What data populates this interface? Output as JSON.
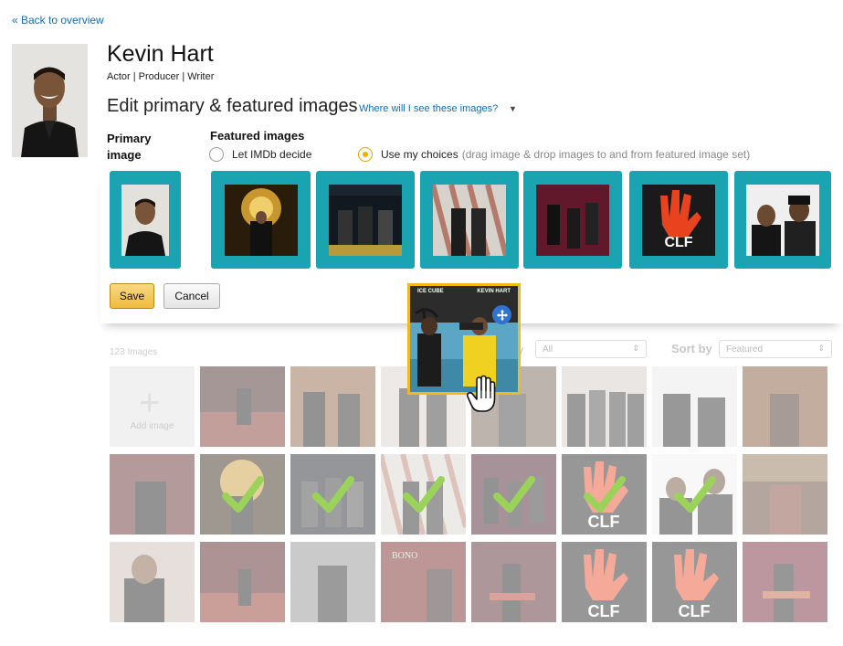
{
  "nav": {
    "back": "« Back to overview"
  },
  "person": {
    "name": "Kevin Hart",
    "roles": "Actor | Producer | Writer"
  },
  "editor": {
    "title": "Edit primary & featured images",
    "help_link": "Where will I see these images?",
    "primary_label": "Primary image",
    "featured_label": "Featured images",
    "option_auto": "Let IMDb decide",
    "option_manual": "Use my choices",
    "option_manual_hint": "(drag image & drop images to and from featured image set)",
    "selected_option": "Use my choices"
  },
  "actions": {
    "save": "Save",
    "cancel": "Cancel"
  },
  "gallery": {
    "count": "123 Images",
    "filter_fragment": "y",
    "filter_value": "All",
    "sort_label": "Sort by",
    "sort_value": "Featured",
    "add_image": "Add image"
  },
  "drag_preview": {
    "left_text": "ICE CUBE",
    "right_text": "KEVIN HART"
  },
  "colors": {
    "featured_tile": "#1aa3b0",
    "accent": "#f0b000",
    "link": "#136cb2",
    "drag_border": "#f3b81b",
    "move_icon": "#2f74d0"
  },
  "icons": {
    "move": "move-arrows-icon",
    "cursor": "hand-cursor-icon",
    "check": "checkmark-icon",
    "plus": "plus-icon"
  }
}
